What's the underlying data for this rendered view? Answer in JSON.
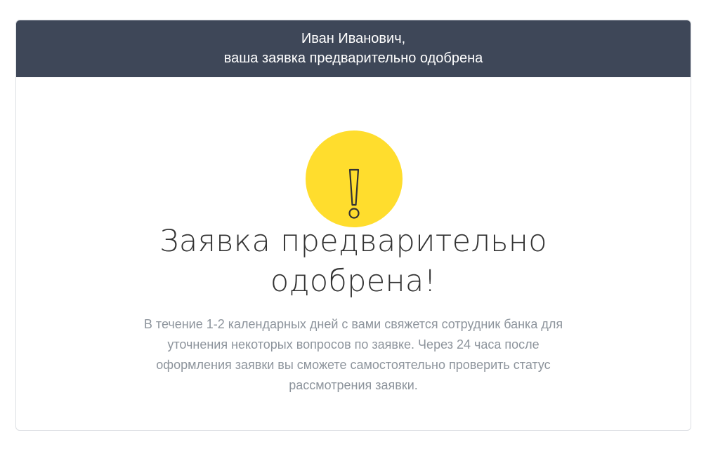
{
  "header": {
    "line1": "Иван Иванович,",
    "line2": "ваша заявка предварительно одобрена"
  },
  "status": {
    "icon": "exclamation-icon",
    "color": "#ffdd2d"
  },
  "main": {
    "title_line1": "Заявка предварительно",
    "title_line2": "одобрена!",
    "description": "В течение 1-2 календарных дней с вами свяжется сотрудник банка для уточнения некоторых вопросов по заявке. Через 24 часа после оформления заявки вы сможете самостоятельно проверить статус рассмотрения заявки."
  },
  "colors": {
    "header_bg": "#3e4758",
    "accent_yellow": "#ffdd2d",
    "text_muted": "#8d949c"
  }
}
